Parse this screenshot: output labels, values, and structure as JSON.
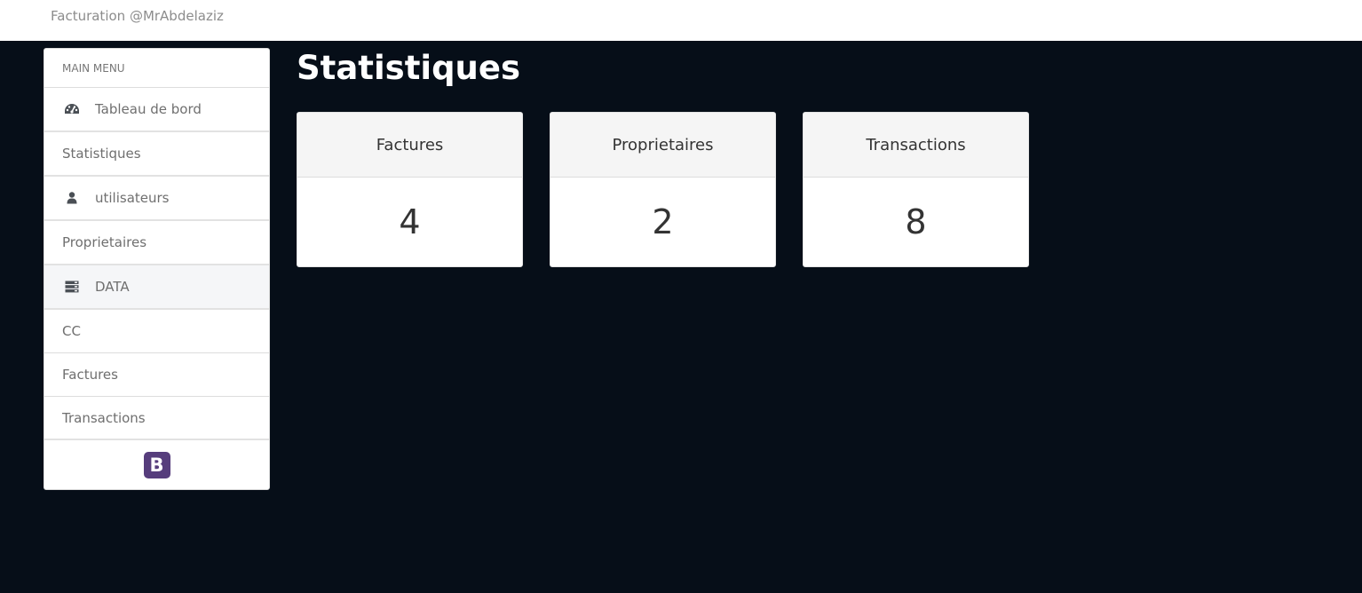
{
  "header": {
    "brand": "Facturation @MrAbdelaziz"
  },
  "sidebar": {
    "header": "MAIN MENU",
    "items": [
      {
        "label": "Tableau de bord",
        "icon": "dashboard-icon"
      },
      {
        "label": "Statistiques"
      },
      {
        "label": "utilisateurs",
        "icon": "user-icon"
      },
      {
        "label": "Proprietaires"
      },
      {
        "label": "DATA",
        "icon": "server-icon",
        "active": true
      },
      {
        "label": "CC"
      },
      {
        "label": "Factures"
      },
      {
        "label": "Transactions"
      }
    ],
    "footer_logo": "B"
  },
  "main": {
    "title": "Statistiques",
    "cards": [
      {
        "label": "Factures",
        "value": "4"
      },
      {
        "label": "Proprietaires",
        "value": "2"
      },
      {
        "label": "Transactions",
        "value": "8"
      }
    ]
  },
  "colors": {
    "background": "#060e18",
    "bootstrap_purple": "#563d7c"
  }
}
